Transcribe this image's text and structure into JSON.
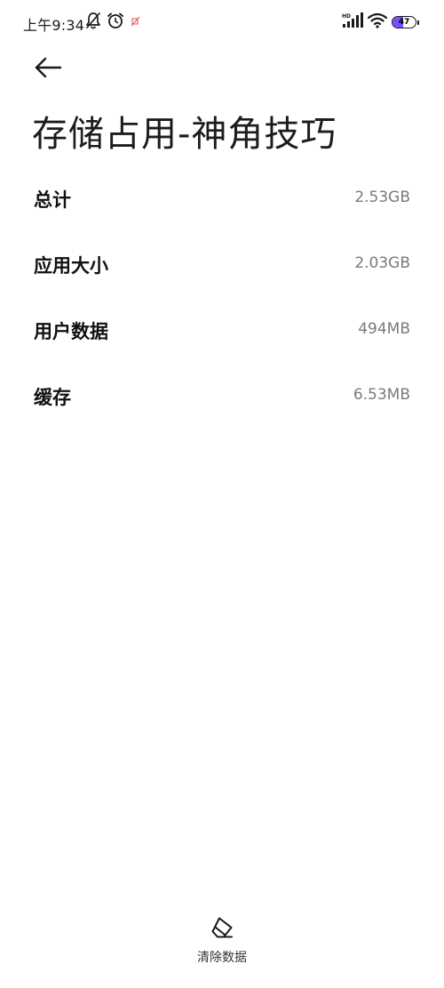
{
  "status_bar": {
    "time": "上午9:34",
    "signal_badge": "HD",
    "battery_level": "47",
    "battery_percent": 47,
    "battery_color": "#7a4dff",
    "icons": [
      "bell-off-icon",
      "alarm-icon",
      "muted-notification-icon",
      "signal-icon",
      "wifi-icon",
      "battery-icon"
    ]
  },
  "header": {
    "back_icon": "arrow-left-icon",
    "title": "存储占用-神角技巧"
  },
  "storage": {
    "items": [
      {
        "label": "总计",
        "value": "2.53GB"
      },
      {
        "label": "应用大小",
        "value": "2.03GB"
      },
      {
        "label": "用户数据",
        "value": "494MB"
      },
      {
        "label": "缓存",
        "value": "6.53MB"
      }
    ]
  },
  "footer": {
    "clear_icon": "eraser-icon",
    "clear_label": "清除数据"
  }
}
